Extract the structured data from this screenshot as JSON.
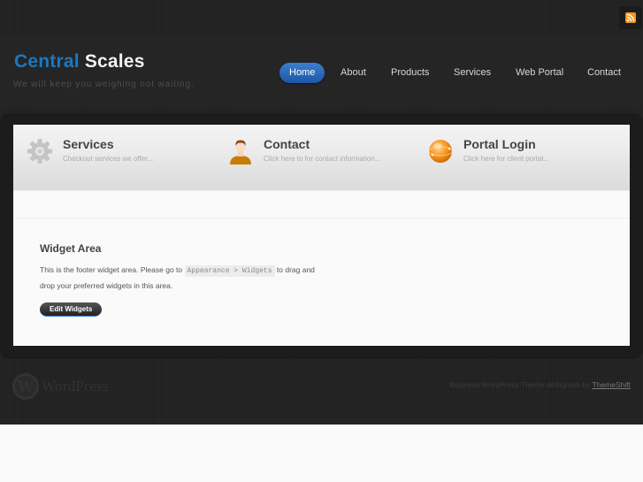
{
  "site": {
    "title_part1": "Central",
    "title_part2": "Scales",
    "tagline": "We will keep you weighing not waiting."
  },
  "header": {
    "rss_icon": "rss-feed-icon"
  },
  "nav": {
    "items": [
      {
        "label": "Home",
        "active": true
      },
      {
        "label": "About",
        "active": false
      },
      {
        "label": "Products",
        "active": false
      },
      {
        "label": "Services",
        "active": false
      },
      {
        "label": "Web Portal",
        "active": false
      },
      {
        "label": "Contact",
        "active": false
      }
    ]
  },
  "features": [
    {
      "icon": "gear-icon",
      "title": "Services",
      "description": "Checkout services we offer..."
    },
    {
      "icon": "user-icon",
      "title": "Contact",
      "description": "Click here to for contact information..."
    },
    {
      "icon": "globe-icon",
      "title": "Portal Login",
      "description": "Click here for client portal..."
    }
  ],
  "widget": {
    "title": "Widget Area",
    "text_before": "This is the footer widget area. Please go to",
    "code": "Appearance > Widgets",
    "text_after": "to drag and drop your preferred widgets in this area.",
    "button_label": "Edit Widgets"
  },
  "footer": {
    "wp_logo_text": "WordPress",
    "credit_text": "Business WordPress Theme deSignum by",
    "credit_link": "ThemeShift"
  },
  "colors": {
    "brand_blue": "#1a78c2",
    "nav_active": "#2a6bbd",
    "rss_orange": "#f7931e"
  }
}
